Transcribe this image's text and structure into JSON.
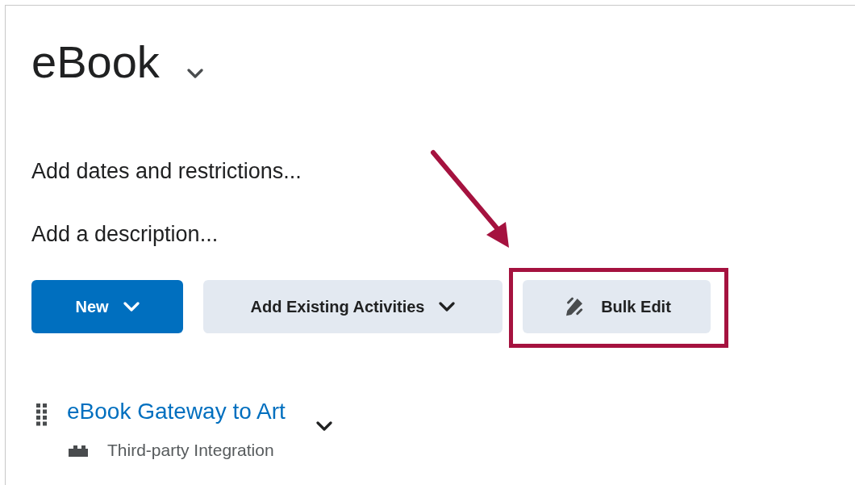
{
  "title": "eBook",
  "links": [
    "Add dates and restrictions...",
    "Add a description..."
  ],
  "buttons": [
    {
      "label": "New",
      "kind": "primary",
      "dropdown": true,
      "highlighted": false
    },
    {
      "label": "Add Existing Activities",
      "kind": "secondary",
      "dropdown": true,
      "highlighted": false
    },
    {
      "label": "Bulk Edit",
      "kind": "edit",
      "dropdown": false,
      "highlighted": true
    }
  ],
  "items": [
    {
      "title": "eBook Gateway to Art",
      "type": "Third-party Integration"
    }
  ]
}
